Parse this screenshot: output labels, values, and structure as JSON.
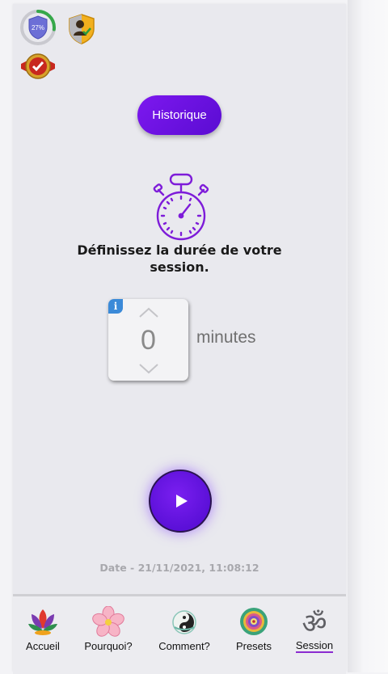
{
  "badges": {
    "progress_text": "27%",
    "progress_fraction": 0.27,
    "progress_color": "#36a84a"
  },
  "header": {
    "history_label": "Historique"
  },
  "session": {
    "prompt": "Définissez la durée de votre session.",
    "info_icon_glyph": "i",
    "duration_value": "0",
    "duration_unit": "minutes"
  },
  "footer": {
    "date_text": "Date - 21/11/2021, 11:08:12"
  },
  "nav": {
    "items": [
      {
        "label": "Accueil",
        "icon": "lotus-icon"
      },
      {
        "label": "Pourquoi?",
        "icon": "flower-icon"
      },
      {
        "label": "Comment?",
        "icon": "yin-yang-icon"
      },
      {
        "label": "Presets",
        "icon": "mandala-icon"
      },
      {
        "label": "Session",
        "icon": "om-icon",
        "active": true
      }
    ]
  },
  "colors": {
    "accent": "#6a12e4",
    "background": "#e9e9ee"
  }
}
